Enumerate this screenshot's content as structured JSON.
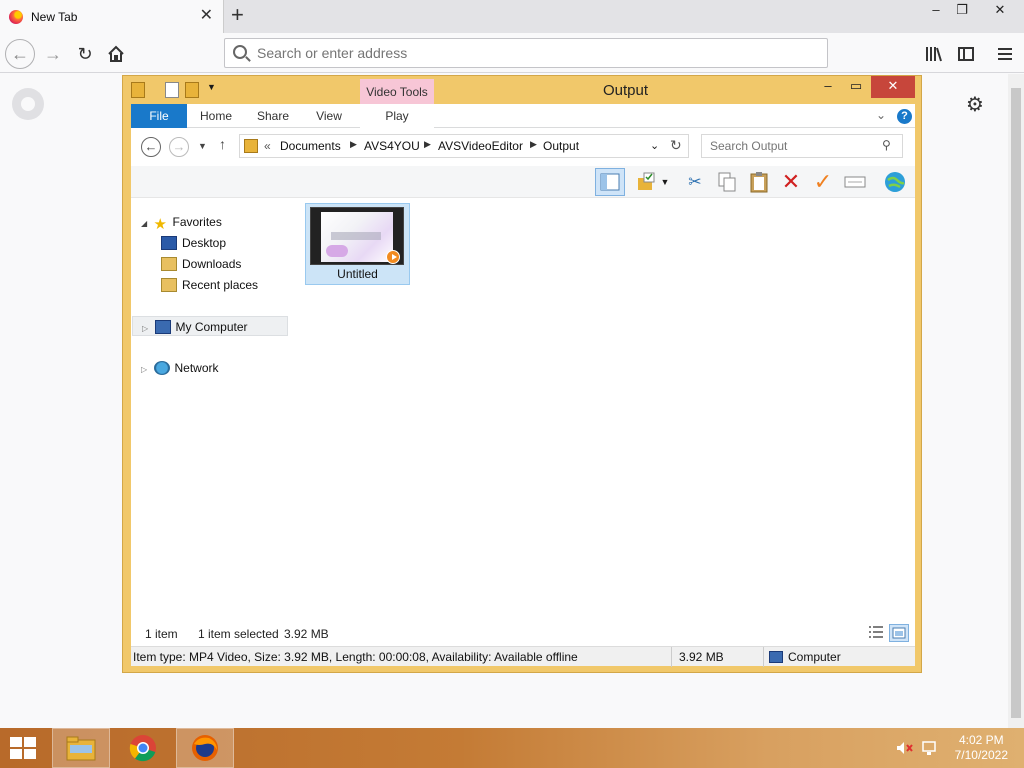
{
  "browser": {
    "tab_title": "New Tab",
    "url_placeholder": "Search or enter address",
    "win_min": "–",
    "win_max": "❐",
    "win_close": "✕"
  },
  "explorer": {
    "title": "Output",
    "context_tab": "Video Tools",
    "ribbon_tabs": [
      "File",
      "Home",
      "Share",
      "View",
      "Play"
    ],
    "breadcrumb": {
      "prefix": "«",
      "items": [
        "Documents",
        "AVS4YOU",
        "AVSVideoEditor",
        "Output"
      ]
    },
    "search_placeholder": "Search Output",
    "nav": {
      "favorites": "Favorites",
      "desktop": "Desktop",
      "downloads": "Downloads",
      "recent": "Recent places",
      "computer": "My Computer",
      "network": "Network"
    },
    "file": {
      "name": "Untitled"
    },
    "status": {
      "count": "1 item",
      "selected": "1 item selected",
      "size": "3.92 MB"
    },
    "details": {
      "info": "Item type: MP4 Video, Size: 3.92 MB, Length: 00:00:08, Availability: Available offline",
      "size": "3.92 MB",
      "location": "Computer"
    },
    "help": "?"
  },
  "taskbar": {
    "time": "4:02 PM",
    "date": "7/10/2022"
  },
  "colors": {
    "window_frame": "#f1c86a",
    "file_tab": "#1979ca",
    "video_tools": "#f7c6d6",
    "selection": "#cce4f7"
  }
}
